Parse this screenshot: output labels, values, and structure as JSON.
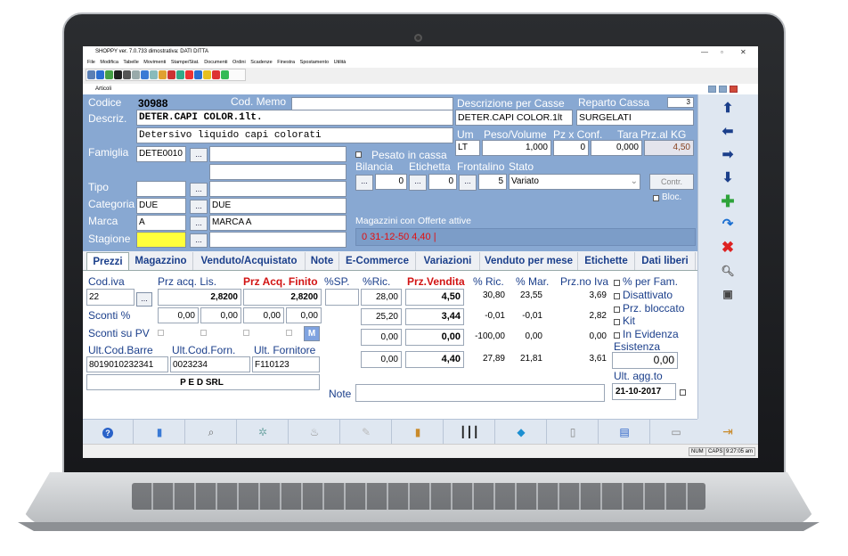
{
  "window": {
    "title": "SHOPPY ver. 7.0.733 dimostrativa: DATI DITTA"
  },
  "menu": [
    "File",
    "Modifica",
    "Tabelle",
    "Movimenti",
    "Stampe/Stat.",
    "Documenti",
    "Ordini",
    "Scadenze",
    "Finestra",
    "Spostamento",
    "Utilità"
  ],
  "child": {
    "title": "Articoli"
  },
  "header": {
    "codice_label": "Codice",
    "codice": "30988",
    "codmemo_label": "Cod. Memo",
    "descr_label": "Descriz.",
    "descr": "DETER.CAPI COLOR.1lt.",
    "descr2": "Detersivo liquido capi colorati",
    "famiglia_label": "Famiglia",
    "famiglia": "DETE0010",
    "tipo_label": "Tipo",
    "categoria_label": "Categoria",
    "categoria": "DUE",
    "categoria_desc": "DUE",
    "marca_label": "Marca",
    "marca": "A",
    "marca_desc": "MARCA A",
    "stagione_label": "Stagione",
    "desc_casse_label": "Descrizione per Casse",
    "desc_casse": "DETER.CAPI COLOR.1lt",
    "reparto_label": "Reparto Cassa",
    "reparto_num": "3",
    "reparto": "SURGELATI",
    "um_label": "Um",
    "um": "LT",
    "peso_label": "Peso/Volume",
    "peso": "1,000",
    "pzconf_label": "Pz x Conf.",
    "pzconf": "0",
    "tara_label": "Tara",
    "tara": "0,000",
    "przkg_label": "Prz.al KG",
    "przkg": "4,50",
    "pesato_label": "Pesato in cassa",
    "bilancia_label": "Bilancia",
    "bilancia": "0",
    "etichetta_label": "Etichetta",
    "etichetta": "0",
    "frontalino_label": "Frontalino",
    "frontalino": "5",
    "stato_label": "Stato",
    "stato": "Variato",
    "contr_label": "Contr.",
    "bloc_label": "Bloc.",
    "magazzini_label": "Magazzini con Offerte attive",
    "offerta": "0 31-12-50 4,40  |"
  },
  "tabs": [
    "Prezzi",
    "Magazzino",
    "Venduto/Acquistato",
    "Note",
    "E-Commerce",
    "Variazioni",
    "Venduto per mese",
    "Etichette",
    "Dati liberi"
  ],
  "prezzi": {
    "codiva_label": "Cod.iva",
    "codiva": "22",
    "przacq_label": "Prz acq. Lis.",
    "przacq": "2,8200",
    "przfinito_label": "Prz Acq. Finito",
    "przfinito": "2,8200",
    "sp_label": "%SP.",
    "ric_label": "%Ric.",
    "przvendita_label": "Prz.Vendita",
    "pric_label": "% Ric.",
    "pmar_label": "% Mar.",
    "przno_label": "Prz.no Iva",
    "sconti_label": "Sconti %",
    "sconti": [
      "0,00",
      "0,00",
      "0,00",
      "0,00"
    ],
    "scontipv_label": "Sconti su PV",
    "m_label": "M",
    "rows": [
      {
        "ric": "28,00",
        "vend": "4,50",
        "pric": "30,80",
        "pmar": "23,55",
        "noiva": "3,69"
      },
      {
        "ric": "25,20",
        "vend": "3,44",
        "pric": "-0,01",
        "pmar": "-0,01",
        "noiva": "2,82"
      },
      {
        "ric": "0,00",
        "vend": "0,00",
        "pric": "-100,00",
        "pmar": "0,00",
        "noiva": "0,00"
      },
      {
        "ric": "0,00",
        "vend": "4,40",
        "pric": "27,89",
        "pmar": "21,81",
        "noiva": "3,61"
      }
    ],
    "perfam_label": "% per Fam.",
    "disattivato_label": "Disattivato",
    "bloccato_label": "Prz. bloccato",
    "kit_label": "Kit",
    "evidenza_label": "In Evidenza",
    "esistenza_label": "Esistenza",
    "esistenza": "0,00",
    "codbarre_label": "Ult.Cod.Barre",
    "codbarre": "8019010232341",
    "codforn_label": "Ult.Cod.Forn.",
    "codforn": "0023234",
    "fornitore_label": "Ult. Fornitore",
    "fornitore": "F110123",
    "fornitore_name": "P E D SRL",
    "note_label": "Note",
    "ultagg_label": "Ult. agg.to",
    "ultagg": "21-10-2017"
  },
  "status": {
    "num": "NUM",
    "caps": "CAPS",
    "time": "9:27:05 am"
  }
}
